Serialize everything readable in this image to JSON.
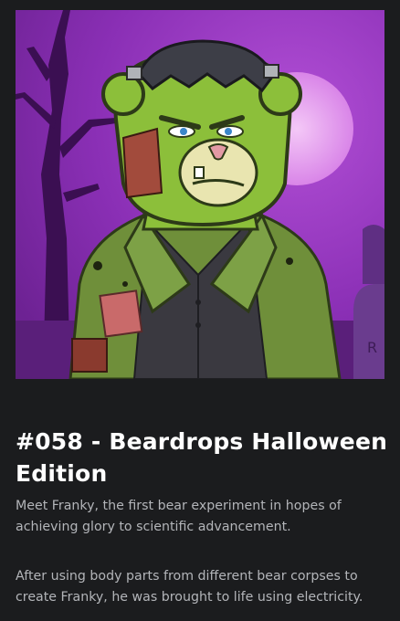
{
  "nft": {
    "title": "#058 - Beardrops Halloween Edition",
    "image_alt": "Frankenstein bear illustration",
    "tombstone_letter": "R",
    "description": [
      "Meet Franky, the first bear experiment in hopes of achieving glory to scientific advancement.",
      "After using body parts from different bear corpses to create Franky, he was brought to life using electricity."
    ]
  },
  "colors": {
    "background": "#1b1c1e",
    "sky": "#8a2fb5",
    "moon": "#e8a7f0",
    "bear_skin": "#8cbf3a",
    "jacket": "#6f8f3a",
    "shirt": "#3a3940",
    "text_primary": "#ffffff",
    "text_secondary": "#b3b5b9"
  }
}
